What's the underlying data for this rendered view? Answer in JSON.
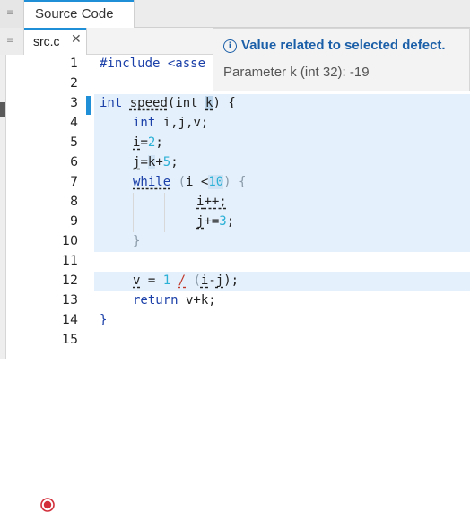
{
  "outer_tab": {
    "label": "Source Code"
  },
  "file_tab": {
    "label": "src.c",
    "close_icon": "✕"
  },
  "tooltip": {
    "icon": "info-icon",
    "title": "Value related to selected defect.",
    "body": "Parameter k (int 32): -19"
  },
  "lines": [
    {
      "n": "1"
    },
    {
      "n": "2"
    },
    {
      "n": "3"
    },
    {
      "n": "4"
    },
    {
      "n": "5"
    },
    {
      "n": "6"
    },
    {
      "n": "7"
    },
    {
      "n": "8"
    },
    {
      "n": "9"
    },
    {
      "n": "10"
    },
    {
      "n": "11"
    },
    {
      "n": "12"
    },
    {
      "n": "13"
    },
    {
      "n": "14"
    },
    {
      "n": "15"
    }
  ],
  "code": {
    "l1_include": "#include <asse",
    "l3_int": "int",
    "l3_func": "speed",
    "l3_paren_int": "(int ",
    "l3_k": "k",
    "l3_rest": ") {",
    "l4_int": "int",
    "l4_rest": " i,j,v;",
    "l5_i": "i",
    "l5_eq": "=",
    "l5_num": "2",
    "l5_semi": ";",
    "l6_j": "j",
    "l6_eq": "=",
    "l6_k": "k",
    "l6_plus": "+",
    "l6_num": "5",
    "l6_semi": ";",
    "l7_while": "while",
    "l7_open": " (",
    "l7_i": "i",
    "l7_lt": " <",
    "l7_num": "10",
    "l7_close": ") {",
    "l8_i": "i",
    "l8_inc": "++;",
    "l9_j": "j",
    "l9_op": "+=",
    "l9_num": "3",
    "l9_semi": ";",
    "l10_brace": "}",
    "l12_v": "v",
    "l12_eq": " = ",
    "l12_one": "1",
    "l12_sp": " ",
    "l12_div": "/",
    "l12_sp2": " ",
    "l12_open": "(",
    "l12_i": "i",
    "l12_minus": "-",
    "l12_j": "j",
    "l12_close": ");",
    "l13_return": "return",
    "l13_rest": " v+k;",
    "l14_brace": "}"
  },
  "colors": {
    "accent": "#1f8fd8",
    "line_highlight": "#e4f0fb",
    "keyword": "#1a3fa8",
    "number": "#2bb0d6",
    "breakpoint": "#d22f3a"
  }
}
